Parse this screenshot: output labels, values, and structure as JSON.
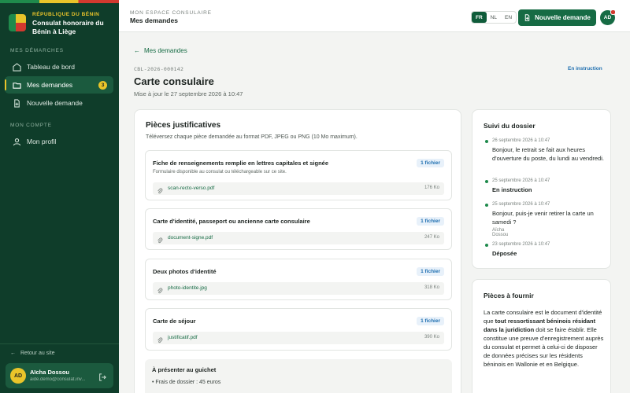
{
  "brand": {
    "country": "RÉPUBLIQUE DU BÉNIN",
    "org": "Consulat honoraire du Bénin à Liège"
  },
  "sidebar": {
    "section1": "MES DÉMARCHES",
    "items": [
      {
        "label": "Tableau de bord",
        "icon": "grid-icon"
      },
      {
        "label": "Mes demandes",
        "icon": "folder-icon",
        "badge": "3"
      },
      {
        "label": "Nouvelle demande",
        "icon": "file-plus-icon"
      }
    ],
    "section2": "MON COMPTE",
    "account_items": [
      {
        "label": "Mon profil",
        "icon": "user-icon"
      }
    ],
    "back_label": "Retour au site",
    "user": {
      "initials": "AD",
      "name": "Aïcha Dossou",
      "email": "aide.demo@consulat.inv..."
    }
  },
  "topbar": {
    "crumb_small": "MON ESPACE CONSULAIRE",
    "crumb_title": "Mes demandes",
    "langs": [
      "FR",
      "NL",
      "EN"
    ],
    "active_lang": "FR",
    "new_button": "Nouvelle demande",
    "avatar": "AD"
  },
  "main": {
    "back_link": "Mes demandes",
    "ref": "CBL-2026-000142",
    "title": "Carte consulaire",
    "updated": "Mise à jour le 27 septembre 2026 à 10:47",
    "status": "En instruction"
  },
  "documents": {
    "title": "Pièces justificatives",
    "hint": "Téléversez chaque pièce demandée au format PDF, JPEG ou PNG (10 Mo maximum).",
    "items": [
      {
        "title": "Fiche de renseignements remplie en lettres capitales et signée",
        "desc": "Formulaire disponible au consulat ou téléchargeable sur ce site.",
        "count": "1 fichier",
        "file": "scan-recto-verso.pdf",
        "size": "176 Ko"
      },
      {
        "title": "Carte d'identité, passeport ou ancienne carte consulaire",
        "desc": "",
        "count": "1 fichier",
        "file": "document-signe.pdf",
        "size": "247 Ko"
      },
      {
        "title": "Deux photos d'identité",
        "desc": "",
        "count": "1 fichier",
        "file": "photo-identite.jpg",
        "size": "318 Ko"
      },
      {
        "title": "Carte de séjour",
        "desc": "",
        "count": "1 fichier",
        "file": "justificatif.pdf",
        "size": "390 Ko"
      }
    ],
    "guichet_title": "À présenter au guichet",
    "guichet_item": "Frais de dossier : 45 euros"
  },
  "follow": {
    "title": "Suivi du dossier",
    "events": [
      {
        "date": "26 septembre 2026 à 10:47",
        "msg": "Bonjour, le retrait se fait aux heures d'ouverture du poste, du lundi au vendredi.",
        "strong": false,
        "who": ""
      },
      {
        "date": "25 septembre 2026 à 10:47",
        "msg": "En instruction",
        "strong": true,
        "who": ""
      },
      {
        "date": "25 septembre 2026 à 10:47",
        "msg": "Bonjour, puis-je venir retirer la carte un samedi ?",
        "strong": false,
        "who": "Aïcha Dossou"
      },
      {
        "date": "23 septembre 2026 à 10:47",
        "msg": "Déposée",
        "strong": true,
        "who": ""
      }
    ]
  },
  "pieces": {
    "title": "Pièces à fournir",
    "text_a": "La carte consulaire est le document d'identité que ",
    "text_b": "tout ressortissant béninois résidant dans la juridiction",
    "text_c": " doit se faire établir. Elle constitue une preuve d'enregistrement auprès du consulat et permet à celui-ci de disposer de données précises sur les résidents béninois en Wallonie et en Belgique."
  }
}
